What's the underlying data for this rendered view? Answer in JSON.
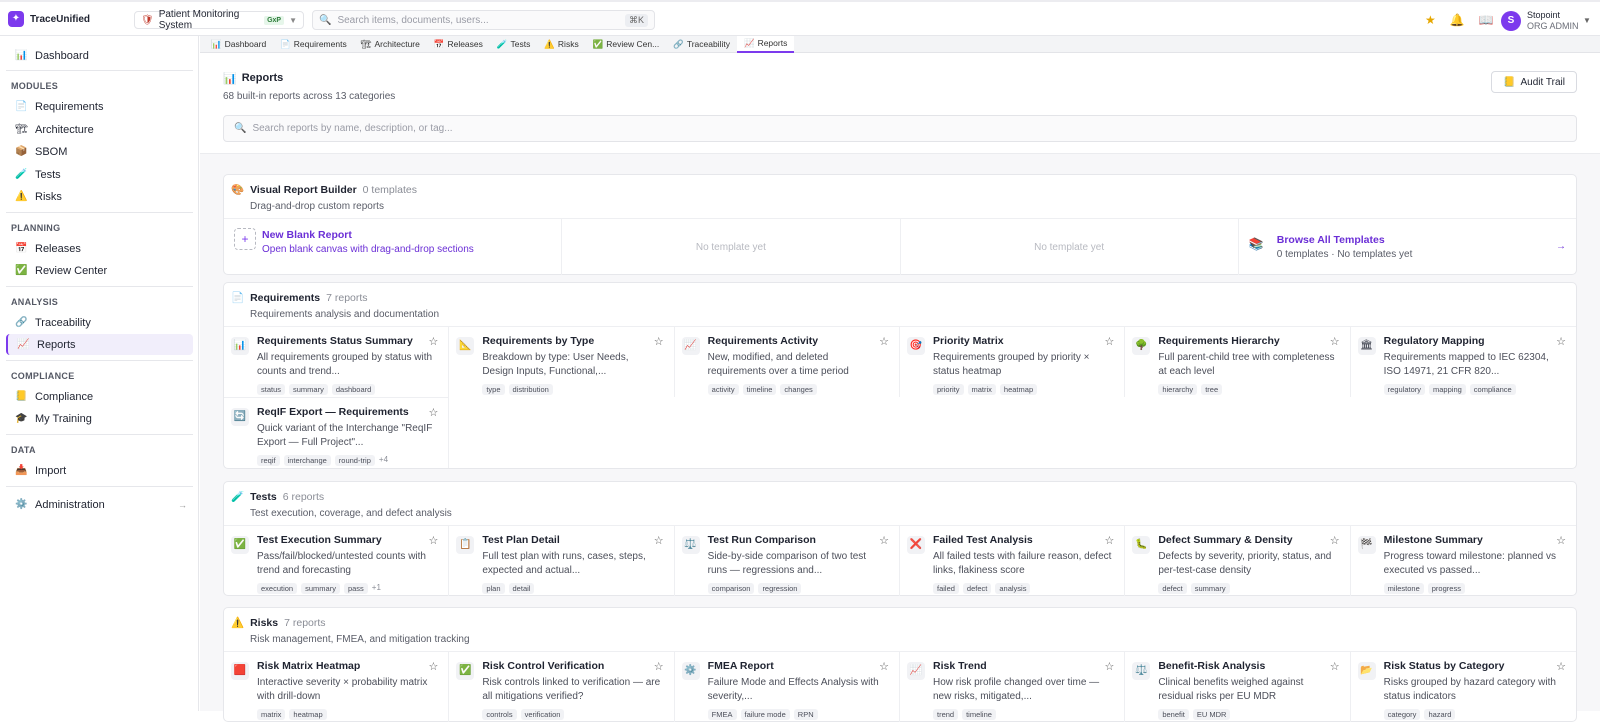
{
  "app": {
    "brand": "TraceUnified",
    "logo_char": "✦"
  },
  "project": {
    "name": "Patient Monitoring System",
    "badge": "GxP"
  },
  "search": {
    "placeholder": "Search items, documents, users...",
    "shortcut": "⌘K"
  },
  "user": {
    "initial": "S",
    "name": "Stopoint",
    "role": "ORG ADMIN"
  },
  "sidebar": {
    "dashboard": "Dashboard",
    "sections": {
      "modules": "MODULES",
      "planning": "PLANNING",
      "analysis": "ANALYSIS",
      "compliance": "COMPLIANCE",
      "data": "DATA"
    },
    "modules": [
      "Requirements",
      "Architecture",
      "SBOM",
      "Tests",
      "Risks"
    ],
    "planning": [
      "Releases",
      "Review Center"
    ],
    "analysis": [
      "Traceability",
      "Reports"
    ],
    "compliance": [
      "Compliance",
      "My Training"
    ],
    "data": [
      "Import"
    ],
    "admin": "Administration"
  },
  "tabs": [
    "Dashboard",
    "Requirements",
    "Architecture",
    "Releases",
    "Tests",
    "Risks",
    "Review Cen...",
    "Traceability",
    "Reports"
  ],
  "page": {
    "title": "Reports",
    "subtitle": "68 built-in reports across 13 categories",
    "audit_label": "Audit Trail",
    "search_placeholder": "Search reports by name, description, or tag..."
  },
  "builder": {
    "title": "Visual Report Builder",
    "count": "0 templates",
    "subtitle": "Drag-and-drop custom reports",
    "new_title": "New Blank Report",
    "new_desc": "Open blank canvas with drag-and-drop sections",
    "empty1": "No template yet",
    "empty2": "No template yet",
    "browse_title": "Browse All Templates",
    "browse_desc": "0 templates · No templates yet"
  },
  "requirements": {
    "title": "Requirements",
    "count": "7 reports",
    "subtitle": "Requirements analysis and documentation",
    "cards": [
      {
        "title": "Requirements Status Summary",
        "desc": "All requirements grouped by status with counts and trend...",
        "tags": [
          "status",
          "summary",
          "dashboard"
        ],
        "more": ""
      },
      {
        "title": "Requirements by Type",
        "desc": "Breakdown by type: User Needs, Design Inputs, Functional,...",
        "tags": [
          "type",
          "distribution"
        ],
        "more": ""
      },
      {
        "title": "Requirements Activity",
        "desc": "New, modified, and deleted requirements over a time period",
        "tags": [
          "activity",
          "timeline",
          "changes"
        ],
        "more": ""
      },
      {
        "title": "Priority Matrix",
        "desc": "Requirements grouped by priority × status heatmap",
        "tags": [
          "priority",
          "matrix",
          "heatmap"
        ],
        "more": ""
      },
      {
        "title": "Requirements Hierarchy",
        "desc": "Full parent-child tree with completeness at each level",
        "tags": [
          "hierarchy",
          "tree"
        ],
        "more": ""
      },
      {
        "title": "Regulatory Mapping",
        "desc": "Requirements mapped to IEC 62304, ISO 14971, 21 CFR 820...",
        "tags": [
          "regulatory",
          "mapping",
          "compliance"
        ],
        "more": ""
      },
      {
        "title": "ReqIF Export — Requirements",
        "desc": "Quick variant of the Interchange \"ReqIF Export — Full Project\"...",
        "tags": [
          "reqif",
          "interchange",
          "round-trip"
        ],
        "more": "+4"
      }
    ]
  },
  "tests": {
    "title": "Tests",
    "count": "6 reports",
    "subtitle": "Test execution, coverage, and defect analysis",
    "cards": [
      {
        "title": "Test Execution Summary",
        "desc": "Pass/fail/blocked/untested counts with trend and forecasting",
        "tags": [
          "execution",
          "summary",
          "pass"
        ],
        "more": "+1"
      },
      {
        "title": "Test Plan Detail",
        "desc": "Full test plan with runs, cases, steps, expected and actual...",
        "tags": [
          "plan",
          "detail"
        ],
        "more": ""
      },
      {
        "title": "Test Run Comparison",
        "desc": "Side-by-side comparison of two test runs — regressions and...",
        "tags": [
          "comparison",
          "regression"
        ],
        "more": ""
      },
      {
        "title": "Failed Test Analysis",
        "desc": "All failed tests with failure reason, defect links, flakiness score",
        "tags": [
          "failed",
          "defect",
          "analysis"
        ],
        "more": ""
      },
      {
        "title": "Defect Summary & Density",
        "desc": "Defects by severity, priority, status, and per-test-case density",
        "tags": [
          "defect",
          "summary"
        ],
        "more": ""
      },
      {
        "title": "Milestone Summary",
        "desc": "Progress toward milestone: planned vs executed vs passed...",
        "tags": [
          "milestone",
          "progress"
        ],
        "more": ""
      }
    ]
  },
  "risks": {
    "title": "Risks",
    "count": "7 reports",
    "subtitle": "Risk management, FMEA, and mitigation tracking",
    "cards": [
      {
        "title": "Risk Matrix Heatmap",
        "desc": "Interactive severity × probability matrix with drill-down",
        "tags": [
          "matrix",
          "heatmap"
        ],
        "more": ""
      },
      {
        "title": "Risk Control Verification",
        "desc": "Risk controls linked to verification — are all mitigations verified?",
        "tags": [
          "controls",
          "verification"
        ],
        "more": ""
      },
      {
        "title": "FMEA Report",
        "desc": "Failure Mode and Effects Analysis with severity,...",
        "tags": [
          "FMEA",
          "failure mode",
          "RPN"
        ],
        "more": ""
      },
      {
        "title": "Risk Trend",
        "desc": "How risk profile changed over time — new risks, mitigated,...",
        "tags": [
          "trend",
          "timeline"
        ],
        "more": ""
      },
      {
        "title": "Benefit-Risk Analysis",
        "desc": "Clinical benefits weighed against residual risks per EU MDR",
        "tags": [
          "benefit",
          "EU MDR"
        ],
        "more": ""
      },
      {
        "title": "Risk Status by Category",
        "desc": "Risks grouped by hazard category with status indicators",
        "tags": [
          "category",
          "hazard"
        ],
        "more": ""
      }
    ]
  }
}
